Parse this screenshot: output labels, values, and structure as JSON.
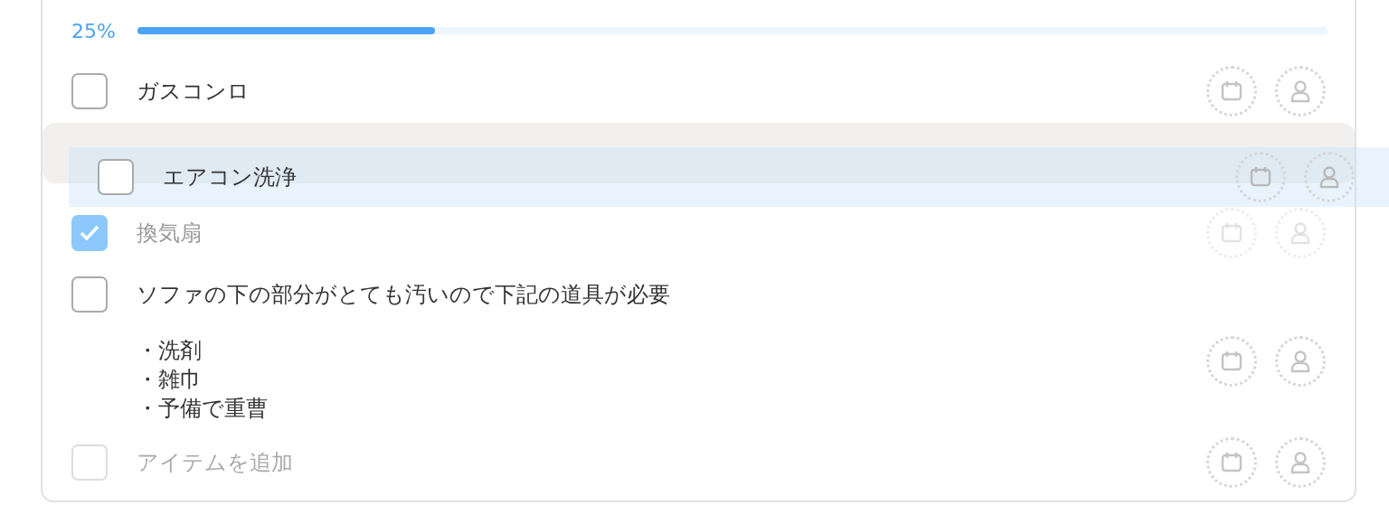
{
  "progress": {
    "label": "25%",
    "level": 0.25
  },
  "items": [
    {
      "text": "ガスコンロ",
      "checked": false,
      "dragging": false
    },
    {
      "text": "エアコン洗浄",
      "checked": false,
      "dragging": true
    },
    {
      "text": "換気扇",
      "checked": true,
      "dragging": false
    },
    {
      "text": "ソファの下の部分がとても汚いので下記の道具が必要",
      "checked": false,
      "dragging": false,
      "notes": [
        "・洗剤",
        "・雑巾",
        "・予備で重曹"
      ]
    }
  ],
  "add_item": {
    "placeholder": "アイテムを追加",
    "checked": false
  }
}
